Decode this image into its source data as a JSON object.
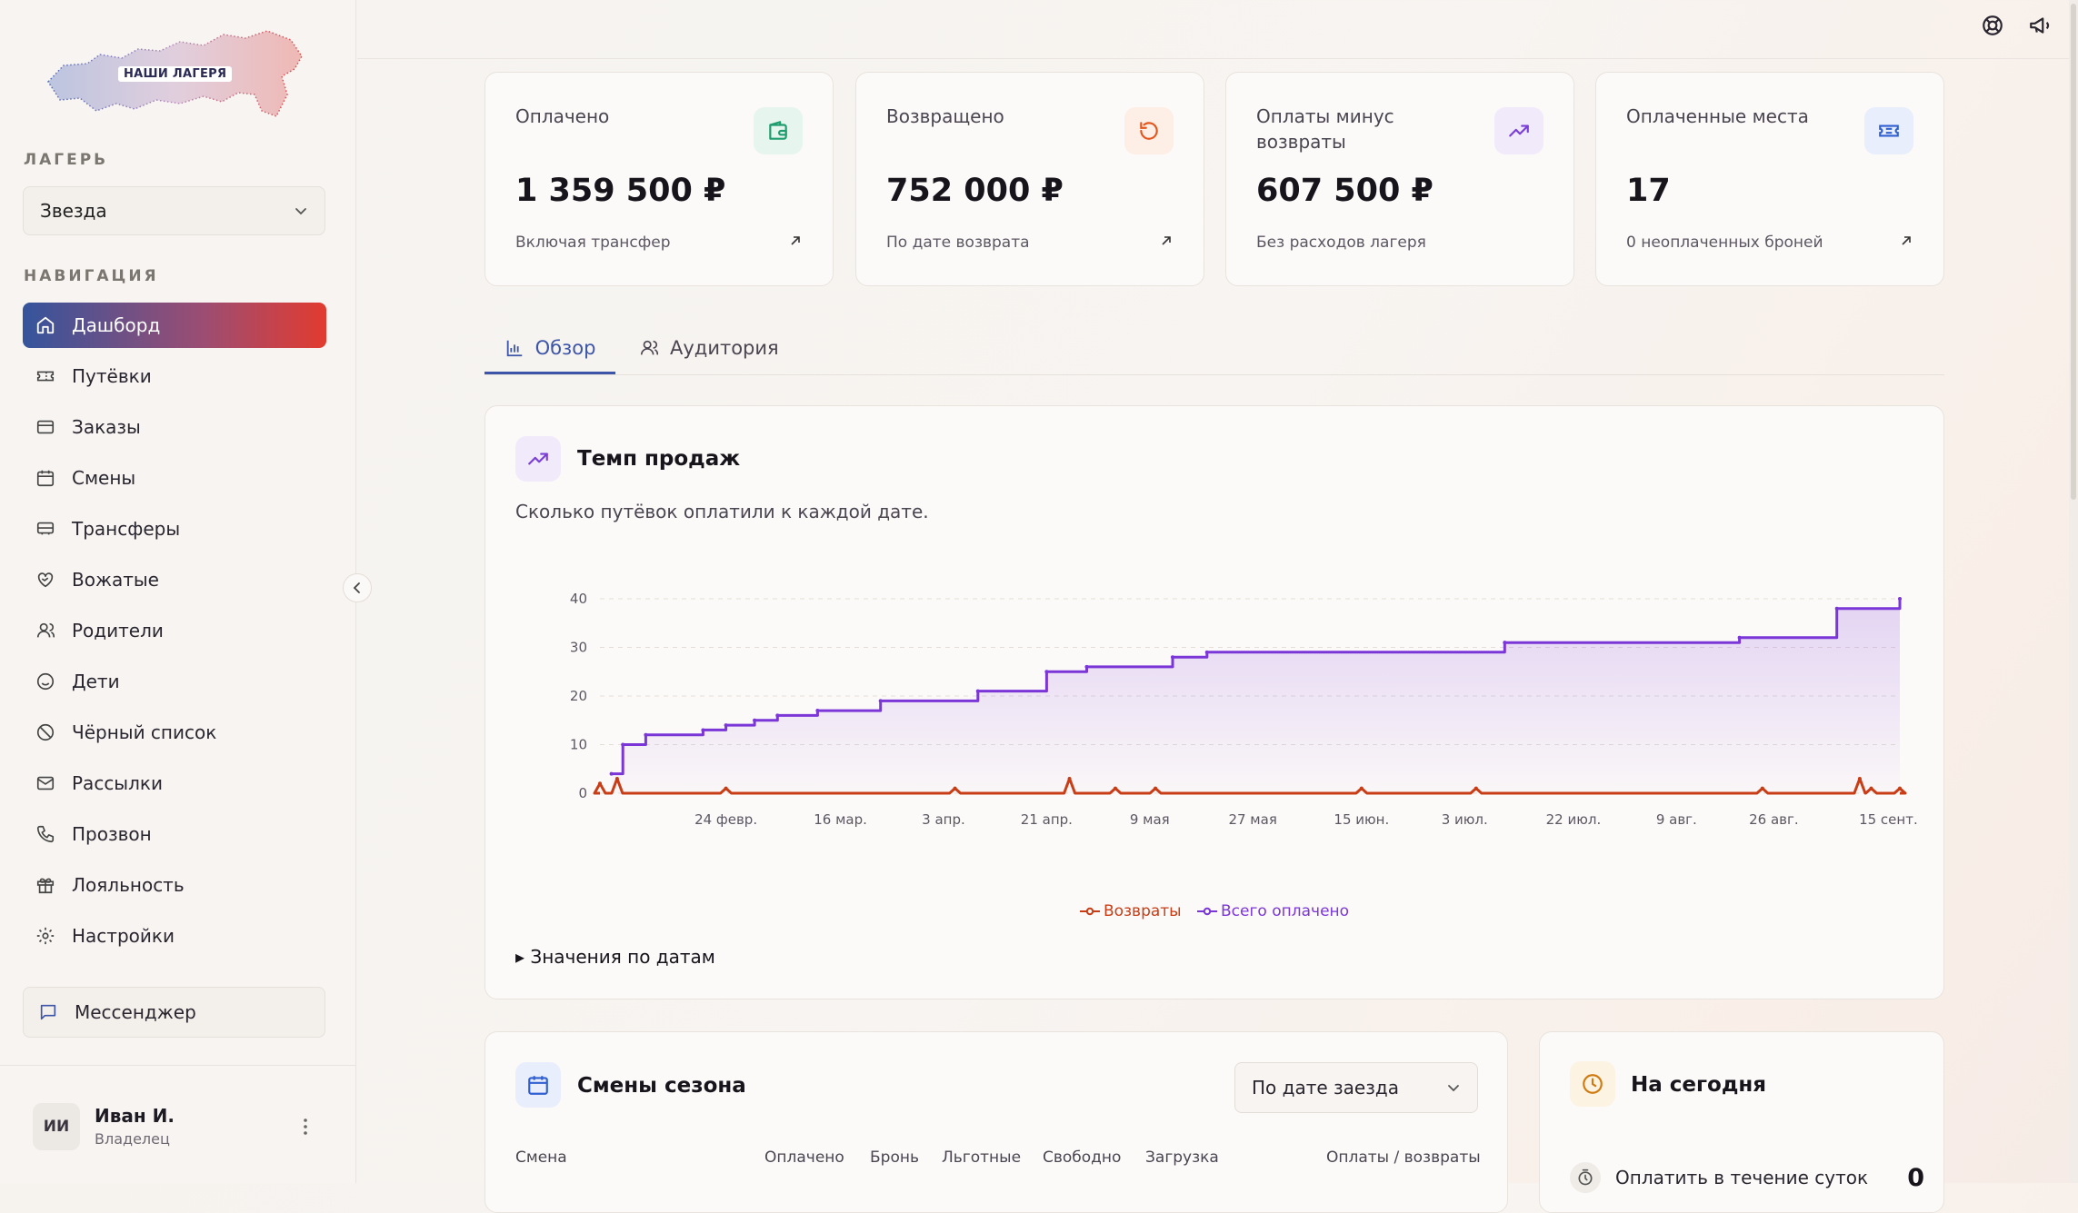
{
  "sidebar": {
    "logo_text": "НАШИ ЛАГЕРЯ",
    "camp_label": "ЛАГЕРЬ",
    "camp_value": "Звезда",
    "nav_label": "НАВИГАЦИЯ",
    "items": [
      {
        "label": "Дашборд",
        "icon": "home-icon"
      },
      {
        "label": "Путёвки",
        "icon": "ticket-icon"
      },
      {
        "label": "Заказы",
        "icon": "card-icon"
      },
      {
        "label": "Смены",
        "icon": "calendar-icon"
      },
      {
        "label": "Трансферы",
        "icon": "bus-icon"
      },
      {
        "label": "Вожатые",
        "icon": "heart-handshake-icon"
      },
      {
        "label": "Родители",
        "icon": "users-icon"
      },
      {
        "label": "Дети",
        "icon": "smile-icon"
      },
      {
        "label": "Чёрный список",
        "icon": "ban-icon"
      },
      {
        "label": "Рассылки",
        "icon": "mail-icon"
      },
      {
        "label": "Прозвон",
        "icon": "phone-icon"
      },
      {
        "label": "Лояльность",
        "icon": "gift-icon"
      },
      {
        "label": "Настройки",
        "icon": "gear-icon"
      }
    ],
    "messenger": "Мессенджер",
    "user": {
      "initials": "ИИ",
      "name": "Иван И.",
      "role": "Владелец"
    }
  },
  "stats": [
    {
      "label": "Оплачено",
      "value": "1 359 500 ₽",
      "sub": "Включая трансфер",
      "icon": "wallet-icon",
      "accent": "#1f9d6e",
      "badge_bg": "#e6f5ee"
    },
    {
      "label": "Возвращено",
      "value": "752 000 ₽",
      "sub": "По дате возврата",
      "icon": "refresh-icon",
      "accent": "#e2571e",
      "badge_bg": "#fdeee6"
    },
    {
      "label": "Оплаты минус возвраты",
      "value": "607 500 ₽",
      "sub": "Без расходов лагеря",
      "icon": "trend-up-icon",
      "accent": "#7a3fd6",
      "badge_bg": "#f1eafb"
    },
    {
      "label": "Оплаченные места",
      "value": "17",
      "sub": "0 неоплаченных броней",
      "icon": "ticket-icon",
      "accent": "#2f5fd0",
      "badge_bg": "#e8eefb"
    }
  ],
  "tabs": [
    {
      "label": "Обзор",
      "icon": "bar-chart-icon",
      "active": true
    },
    {
      "label": "Аудитория",
      "icon": "users-icon",
      "active": false
    }
  ],
  "sales": {
    "title": "Темп продаж",
    "description": "Сколько путёвок оплатили к каждой дате.",
    "details_toggle": "▸ Значения по датам"
  },
  "chart_data": {
    "type": "line",
    "ylim": [
      0,
      40
    ],
    "yticks": [
      0,
      10,
      20,
      30,
      40
    ],
    "xticks": [
      "24 февр.",
      "16 мар.",
      "3 апр.",
      "21 апр.",
      "9 мая",
      "27 мая",
      "15 июн.",
      "3 июл.",
      "22 июл.",
      "9 авг.",
      "26 авг.",
      "15 сент."
    ],
    "grid": true,
    "legend_position": "bottom",
    "series": [
      {
        "name": "Всего оплачено",
        "color": "#7b36d8",
        "area": true,
        "x": [
          "4 февр.",
          "6 февр.",
          "10 февр.",
          "20 февр.",
          "24 февр.",
          "1 мар.",
          "5 мар.",
          "12 мар.",
          "23 мар.",
          "9 апр.",
          "21 апр.",
          "28 апр.",
          "13 мая",
          "19 мая",
          "10 июл.",
          "20 авг.",
          "6 сент.",
          "17 сент."
        ],
        "values": [
          4,
          10,
          12,
          13,
          14,
          15,
          16,
          17,
          19,
          21,
          25,
          26,
          28,
          29,
          31,
          32,
          38,
          40
        ]
      },
      {
        "name": "Возвраты",
        "color": "#c83d16",
        "area": false,
        "x": [
          "2 февр.",
          "5 февр.",
          "24 февр.",
          "5 апр.",
          "25 апр.",
          "3 мая",
          "10 мая",
          "15 июн.",
          "5 июл.",
          "24 авг.",
          "10 сент.",
          "12 сент.",
          "17 сент."
        ],
        "values": [
          2,
          3,
          1,
          1,
          3,
          1,
          1,
          1,
          1,
          1,
          3,
          1,
          1
        ]
      }
    ]
  },
  "season": {
    "title": "Смены сезона",
    "sort_value": "По дате заезда",
    "columns": [
      "Смена",
      "Оплачено",
      "Бронь",
      "Льготные",
      "Свободно",
      "Загрузка",
      "Оплаты / возвраты"
    ]
  },
  "today": {
    "title": "На сегодня",
    "rows": [
      {
        "label": "Оплатить в течение суток",
        "count": "0",
        "icon": "timer-icon"
      }
    ]
  }
}
